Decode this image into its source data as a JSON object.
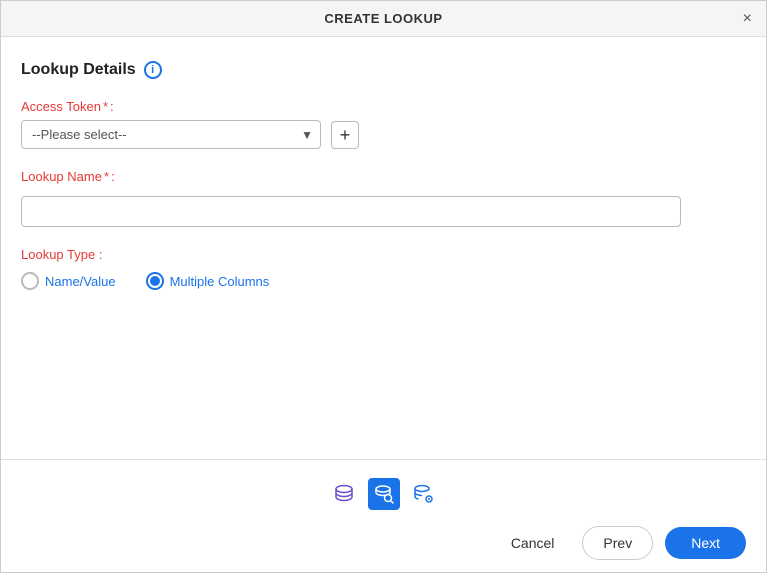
{
  "dialog": {
    "title": "CREATE LOOKUP",
    "close_label": "×"
  },
  "section": {
    "title": "Lookup Details",
    "info_icon": "i"
  },
  "access_token": {
    "label": "Access Token",
    "required": "*",
    "colon": ":",
    "placeholder": "--Please select--",
    "add_button": "+"
  },
  "lookup_name": {
    "label": "Lookup Name",
    "required": "*",
    "colon": ":",
    "value": ""
  },
  "lookup_type": {
    "label": "Lookup Type",
    "colon": ":",
    "options": [
      {
        "id": "name_value",
        "label": "Name/Value",
        "checked": false
      },
      {
        "id": "multiple_columns",
        "label": "Multiple Columns",
        "checked": true
      }
    ]
  },
  "footer": {
    "icons": [
      {
        "name": "database-icon",
        "active": false
      },
      {
        "name": "search-database-icon",
        "active": true
      },
      {
        "name": "database-settings-icon",
        "active": false
      }
    ],
    "buttons": {
      "cancel": "Cancel",
      "prev": "Prev",
      "next": "Next"
    }
  }
}
